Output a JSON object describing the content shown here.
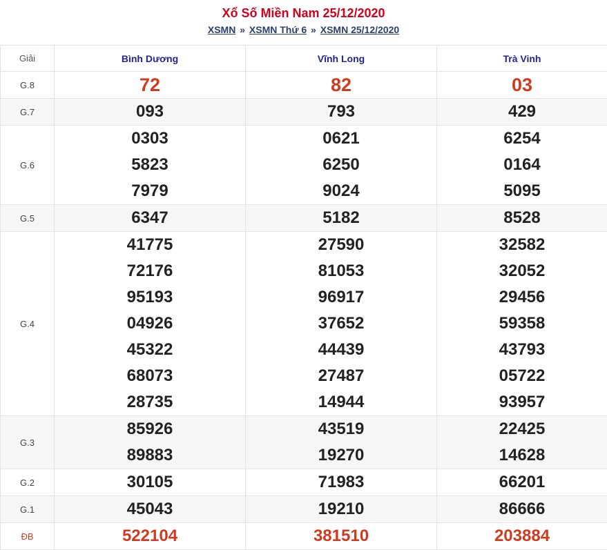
{
  "header": {
    "title": "Xổ Số Miền Nam 25/12/2020",
    "breadcrumb": {
      "link1": "XSMN",
      "sep1": "»",
      "link2": "XSMN Thứ 6",
      "sep2": "»",
      "link3": "XSMN 25/12/2020"
    }
  },
  "table": {
    "giai_header": "Giải",
    "provinces": [
      "Bình Dương",
      "Vĩnh Long",
      "Trà Vinh"
    ],
    "prizes": {
      "g8": {
        "label": "G.8",
        "values": [
          [
            "72"
          ],
          [
            "82"
          ],
          [
            "03"
          ]
        ]
      },
      "g7": {
        "label": "G.7",
        "values": [
          [
            "093"
          ],
          [
            "793"
          ],
          [
            "429"
          ]
        ]
      },
      "g6": {
        "label": "G.6",
        "values": [
          [
            "0303",
            "5823",
            "7979"
          ],
          [
            "0621",
            "6250",
            "9024"
          ],
          [
            "6254",
            "0164",
            "5095"
          ]
        ]
      },
      "g5": {
        "label": "G.5",
        "values": [
          [
            "6347"
          ],
          [
            "5182"
          ],
          [
            "8528"
          ]
        ]
      },
      "g4": {
        "label": "G.4",
        "values": [
          [
            "41775",
            "72176",
            "95193",
            "04926",
            "45322",
            "68073",
            "28735"
          ],
          [
            "27590",
            "81053",
            "96917",
            "37652",
            "44439",
            "27487",
            "14944"
          ],
          [
            "32582",
            "32052",
            "29456",
            "59358",
            "43793",
            "05722",
            "93957"
          ]
        ]
      },
      "g3": {
        "label": "G.3",
        "values": [
          [
            "85926",
            "89883"
          ],
          [
            "43519",
            "19270"
          ],
          [
            "22425",
            "14628"
          ]
        ]
      },
      "g2": {
        "label": "G.2",
        "values": [
          [
            "30105"
          ],
          [
            "71983"
          ],
          [
            "66201"
          ]
        ]
      },
      "g1": {
        "label": "G.1",
        "values": [
          [
            "45043"
          ],
          [
            "19210"
          ],
          [
            "86666"
          ]
        ]
      },
      "db": {
        "label": "ĐB",
        "values": [
          [
            "522104"
          ],
          [
            "381510"
          ],
          [
            "203884"
          ]
        ]
      }
    }
  },
  "colors": {
    "title_red": "#d0021b",
    "special_red": "#d03a1f",
    "province_blue": "#23238e",
    "link_navy": "#2c3e6b",
    "alt_row_bg": "#f6f6f6"
  }
}
